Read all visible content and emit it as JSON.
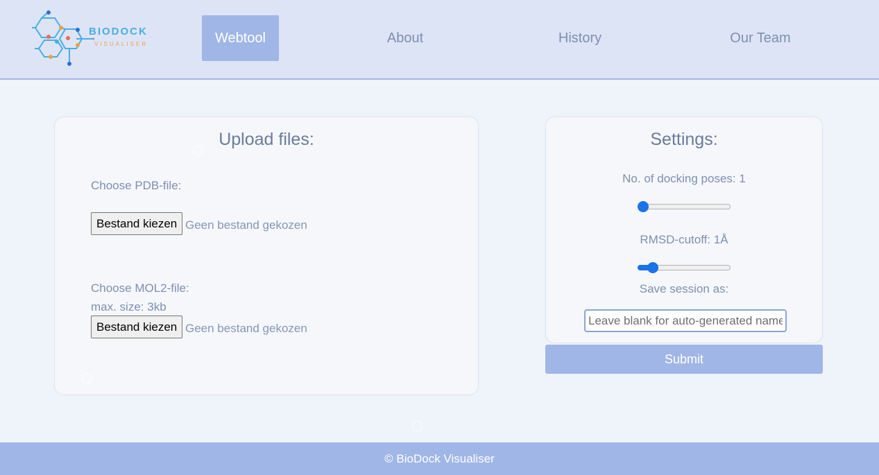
{
  "brand": {
    "title": "BIODOCK",
    "subtitle": "VISUALISER",
    "colors": {
      "primary": "#a0b6e6",
      "accent": "#1a73e8",
      "logo_blue": "#49aee0",
      "logo_orange": "#e8a24a"
    }
  },
  "nav": {
    "items": [
      {
        "label": "Webtool",
        "active": true
      },
      {
        "label": "About",
        "active": false
      },
      {
        "label": "History",
        "active": false
      },
      {
        "label": "Our Team",
        "active": false
      }
    ]
  },
  "upload": {
    "title": "Upload files:",
    "pdb_label": "Choose PDB-file:",
    "pdb_button": "Bestand kiezen",
    "pdb_status": "Geen bestand gekozen",
    "mol2_label": "Choose MOL2-file:",
    "mol2_size": "max. size: 3kb",
    "mol2_button": "Bestand kiezen",
    "mol2_status": "Geen bestand gekozen"
  },
  "settings": {
    "title": "Settings:",
    "poses_label": "No. of docking poses: 1",
    "poses_slider_fraction": 0,
    "rmsd_label": "RMSD-cutoff: 1Å",
    "rmsd_slider_fraction": 0.12,
    "save_label": "Save session as:",
    "name_placeholder": "Leave blank for auto-generated name",
    "submit_label": "Submit"
  },
  "footer": {
    "text": "© BioDock Visualiser"
  }
}
